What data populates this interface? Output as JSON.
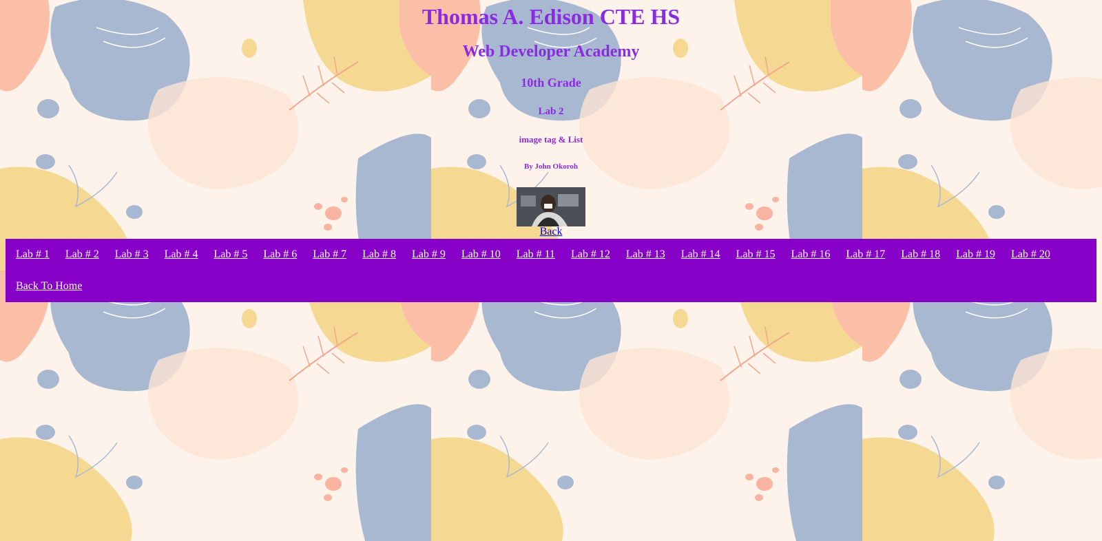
{
  "header": {
    "school": "Thomas A. Edison CTE HS",
    "academy": "Web Developer Academy",
    "grade": "10th Grade",
    "lab": "Lab 2",
    "topic": "image tag & List",
    "author": "By John Okoroh"
  },
  "back_link": "Back",
  "nav": {
    "items": [
      "Lab # 1",
      "Lab # 2",
      "Lab # 3",
      "Lab # 4",
      "Lab # 5",
      "Lab # 6",
      "Lab # 7",
      "Lab # 8",
      "Lab # 9",
      "Lab # 10",
      "Lab # 11",
      "Lab # 12",
      "Lab # 13",
      "Lab # 14",
      "Lab # 15",
      "Lab # 16",
      "Lab # 17",
      "Lab # 18",
      "Lab # 19",
      "Lab # 20",
      "Back To Home"
    ]
  },
  "colors": {
    "heading": "#8a2be2",
    "nav_bg": "#8700c8",
    "link": "#0000ee"
  }
}
